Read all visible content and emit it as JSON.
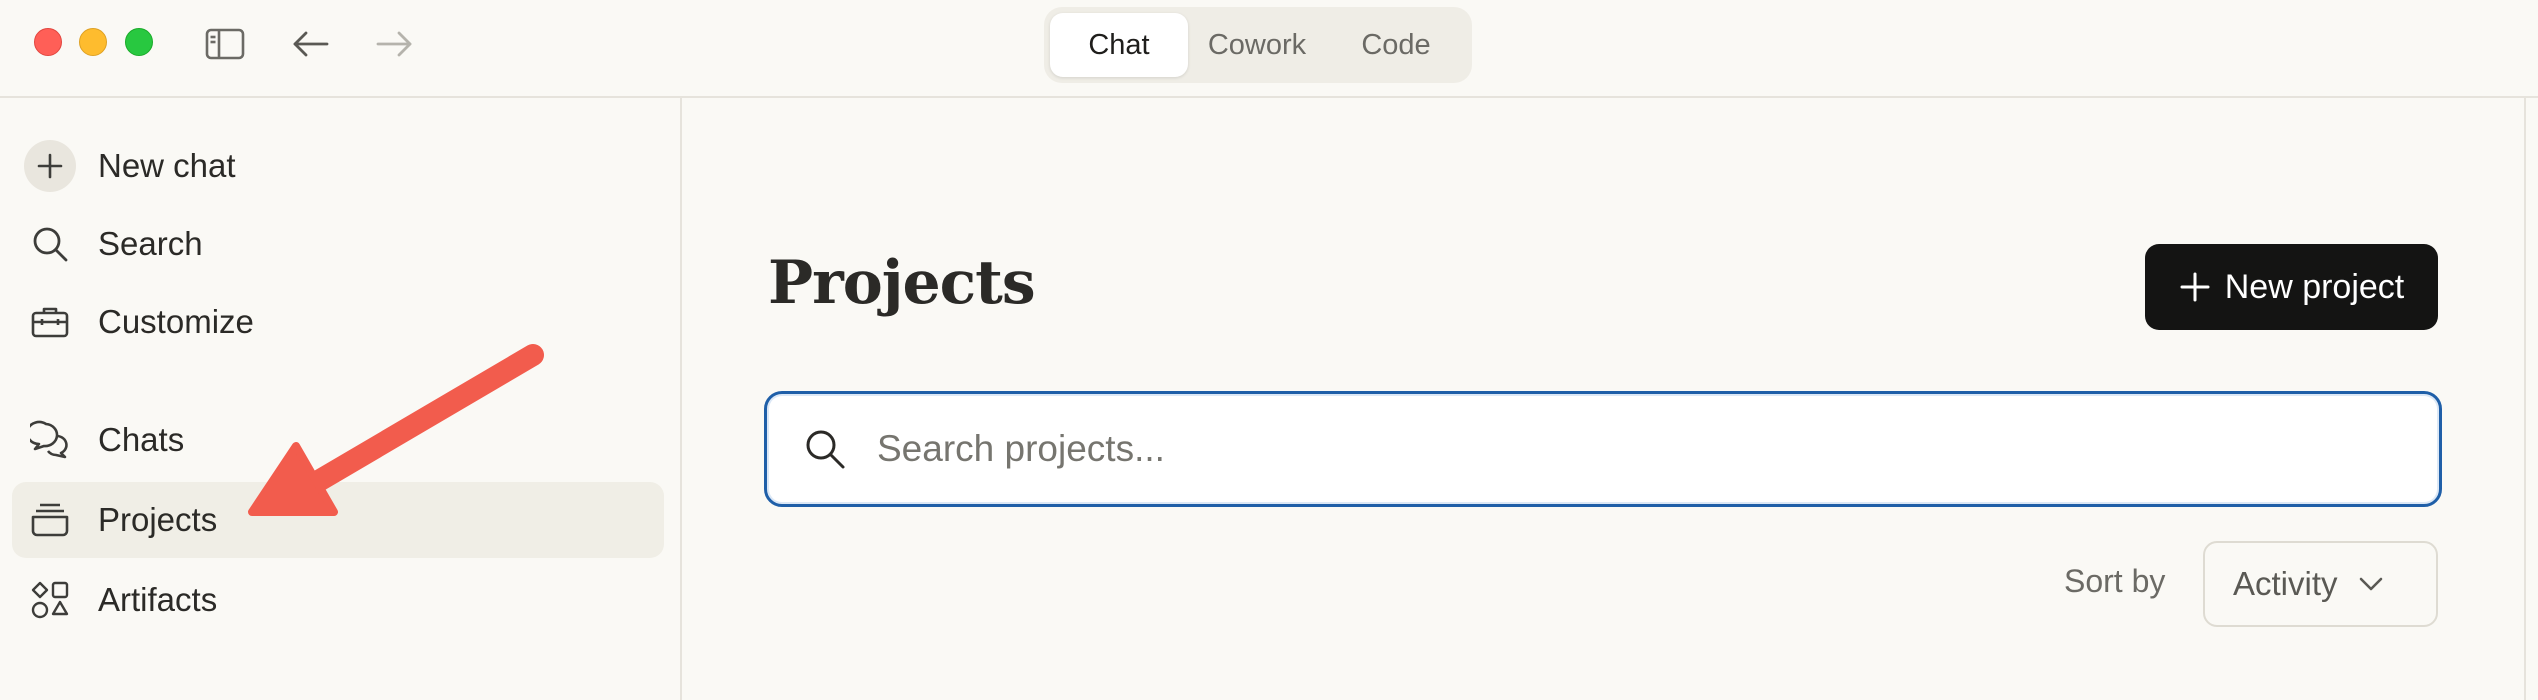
{
  "window": {
    "controls": [
      "close",
      "minimize",
      "zoom"
    ],
    "toolbar_icons": [
      "sidebar-toggle-icon",
      "arrow-left-icon",
      "arrow-right-icon"
    ]
  },
  "modes": {
    "tabs": [
      {
        "label": "Chat",
        "active": true
      },
      {
        "label": "Cowork",
        "active": false
      },
      {
        "label": "Code",
        "active": false
      }
    ]
  },
  "sidebar": {
    "items": [
      {
        "label": "New chat",
        "icon": "plus-icon"
      },
      {
        "label": "Search",
        "icon": "search-icon"
      },
      {
        "label": "Customize",
        "icon": "briefcase-icon"
      },
      {
        "label": "Chats",
        "icon": "chat-bubbles-icon"
      },
      {
        "label": "Projects",
        "icon": "projects-stack-icon",
        "active": true
      },
      {
        "label": "Artifacts",
        "icon": "shapes-icon"
      }
    ]
  },
  "main": {
    "title": "Projects",
    "new_project_label": "New project",
    "search": {
      "placeholder": "Search projects...",
      "value": ""
    },
    "sort": {
      "label": "Sort by",
      "selected": "Activity"
    }
  },
  "colors": {
    "background": "#faf9f5",
    "accent_focus": "#1f5fa8",
    "primary_button": "#141413",
    "annotation_arrow": "#f25c4d"
  }
}
